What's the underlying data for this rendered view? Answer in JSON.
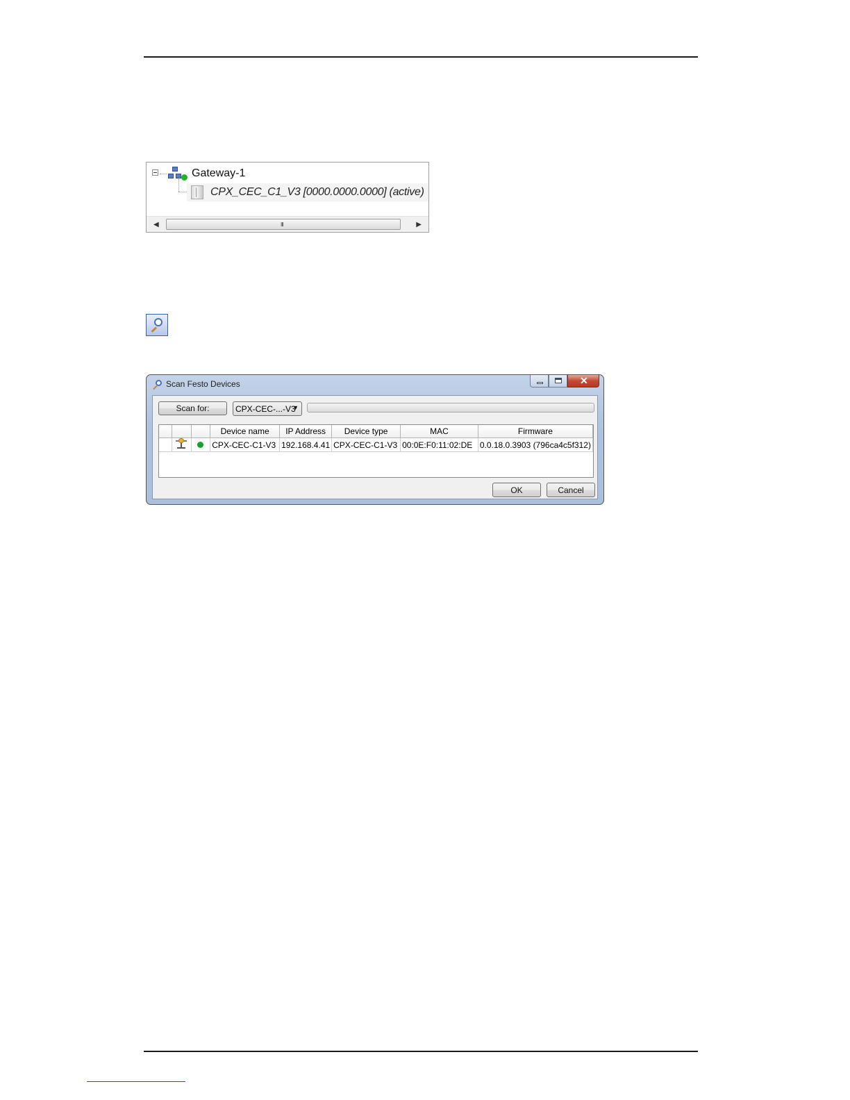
{
  "tree": {
    "gateway_label": "Gateway-1",
    "device_label": "CPX_CEC_C1_V3 [0000.0000.0000] (active)",
    "scroll_grip": "III",
    "icons": [
      "collapse-icon",
      "network-icon",
      "device-module-icon"
    ],
    "status_color": "#21b521"
  },
  "toolbar_button": {
    "icon": "magnifier-icon"
  },
  "dialog": {
    "title": "Scan Festo Devices",
    "caption_close": "✕",
    "scan_for_label": "Scan for:",
    "device_filter": "CPX-CEC-...-V3",
    "columns": [
      "",
      "",
      "",
      "Device name",
      "IP Address",
      "Device type",
      "MAC",
      "Firmware"
    ],
    "rows": [
      {
        "device_name": "CPX-CEC-C1-V3",
        "ip_address": "192.168.4.41",
        "device_type": "CPX-CEC-C1-V3",
        "mac": "00:0E:F0:11:02:DE",
        "firmware": "0.0.18.0.3903 (796ca4c5f312)",
        "status_color": "#18a02a"
      }
    ],
    "ok_label": "OK",
    "cancel_label": "Cancel"
  }
}
